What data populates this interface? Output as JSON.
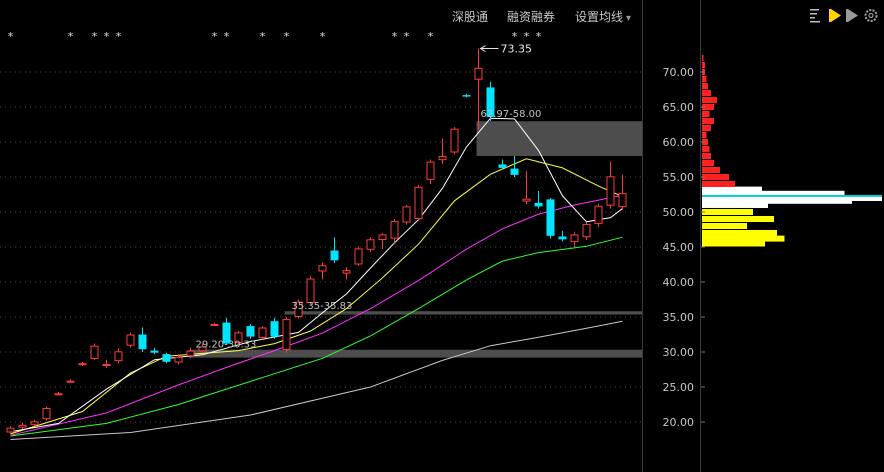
{
  "toolbar": {
    "items": [
      "深股通",
      "融资融券",
      "设置均线"
    ],
    "dropdown_glyph": "▾"
  },
  "right_icons": [
    "bars-icon",
    "play-yellow-icon",
    "play-grey-icon",
    "gear-icon"
  ],
  "colors": {
    "background": "#000000",
    "up": "#ff3a3a",
    "down": "#00e5ff",
    "ma5": "#ffffff",
    "ma10": "#ffff44",
    "ma20": "#ff30ff",
    "ma30": "#30ff30",
    "ma60": "#c8c8c8",
    "axis_text": "#c8c8c8",
    "highlight_box": "#555555"
  },
  "chart_data": {
    "type": "candlestick",
    "price_axis": {
      "min": 15,
      "max": 77,
      "ticks": [
        "20.00",
        "25.00",
        "30.00",
        "35.00",
        "40.00",
        "45.00",
        "50.00",
        "55.00",
        "60.00",
        "65.00",
        "70.00"
      ]
    },
    "candles": [
      [
        18.5,
        19.4,
        18.3,
        19.2
      ],
      [
        19.2,
        19.9,
        19.0,
        19.6
      ],
      [
        19.6,
        20.3,
        19.4,
        20.1
      ],
      [
        20.4,
        22.2,
        20.2,
        22.0
      ],
      [
        24.0,
        24.3,
        23.8,
        24.1
      ],
      [
        25.8,
        26.1,
        25.6,
        25.9
      ],
      [
        28.2,
        28.6,
        28.0,
        28.4
      ],
      [
        29.0,
        31.2,
        28.9,
        30.9
      ],
      [
        28.0,
        28.9,
        27.7,
        28.3
      ],
      [
        28.7,
        30.5,
        28.4,
        30.1
      ],
      [
        30.9,
        32.8,
        30.6,
        32.5
      ],
      [
        32.5,
        33.5,
        30.0,
        30.4
      ],
      [
        30.2,
        30.6,
        29.7,
        29.9
      ],
      [
        29.7,
        29.9,
        28.4,
        28.6
      ],
      [
        28.5,
        29.7,
        28.2,
        29.3
      ],
      [
        29.4,
        30.6,
        29.1,
        30.2
      ],
      [
        30.1,
        31.2,
        29.9,
        30.8
      ],
      [
        33.9,
        34.2,
        33.8,
        34.0
      ],
      [
        34.2,
        34.9,
        31.0,
        31.2
      ],
      [
        31.3,
        33.0,
        31.0,
        32.8
      ],
      [
        33.7,
        34.0,
        31.9,
        32.2
      ],
      [
        32.0,
        33.7,
        31.8,
        33.5
      ],
      [
        34.4,
        34.9,
        31.9,
        32.2
      ],
      [
        30.3,
        35.0,
        29.9,
        34.7
      ],
      [
        35.0,
        37.5,
        34.8,
        37.2
      ],
      [
        37.0,
        40.8,
        36.8,
        40.5
      ],
      [
        41.5,
        42.8,
        40.4,
        42.4
      ],
      [
        44.5,
        46.4,
        42.7,
        43.1
      ],
      [
        41.2,
        42.1,
        40.4,
        41.7
      ],
      [
        42.5,
        45.1,
        42.3,
        44.8
      ],
      [
        44.6,
        46.4,
        44.3,
        46.1
      ],
      [
        46.0,
        47.0,
        44.7,
        46.8
      ],
      [
        46.2,
        49.0,
        45.6,
        48.7
      ],
      [
        48.5,
        51.0,
        48.2,
        50.8
      ],
      [
        49.0,
        53.9,
        48.7,
        53.6
      ],
      [
        54.6,
        57.5,
        54.0,
        57.2
      ],
      [
        57.4,
        60.5,
        56.9,
        58.0
      ],
      [
        58.5,
        62.1,
        58.2,
        61.9
      ],
      [
        66.7,
        66.9,
        66.4,
        66.6
      ],
      [
        68.9,
        73.35,
        61.8,
        70.6
      ],
      [
        67.8,
        68.6,
        63.0,
        63.6
      ],
      [
        56.8,
        57.5,
        56.1,
        56.3
      ],
      [
        56.2,
        58.0,
        55.0,
        55.3
      ],
      [
        51.5,
        55.8,
        51.1,
        51.9
      ],
      [
        51.3,
        53.0,
        50.5,
        50.8
      ],
      [
        51.8,
        52.0,
        46.2,
        46.6
      ],
      [
        46.5,
        47.3,
        45.8,
        46.1
      ],
      [
        45.7,
        47.1,
        45.0,
        46.8
      ],
      [
        46.4,
        48.5,
        46.0,
        48.3
      ],
      [
        48.3,
        51.2,
        47.8,
        50.9
      ],
      [
        50.9,
        57.2,
        50.5,
        55.1
      ],
      [
        50.7,
        55.3,
        50.3,
        52.7
      ]
    ],
    "ma5": [
      [
        0,
        18.6
      ],
      [
        4,
        19.8
      ],
      [
        8,
        24.7
      ],
      [
        12,
        28.9
      ],
      [
        16,
        29.6
      ],
      [
        20,
        31.5
      ],
      [
        24,
        32.8
      ],
      [
        26,
        35.6
      ],
      [
        28,
        38.3
      ],
      [
        30,
        42.0
      ],
      [
        32,
        45.6
      ],
      [
        34,
        48.9
      ],
      [
        36,
        53.4
      ],
      [
        38,
        59.3
      ],
      [
        40,
        63.4
      ],
      [
        42,
        63.3
      ],
      [
        44,
        58.8
      ],
      [
        46,
        52.3
      ],
      [
        48,
        48.6
      ],
      [
        50,
        49.2
      ],
      [
        51,
        50.5
      ]
    ],
    "ma10": [
      [
        0,
        18.3
      ],
      [
        6,
        21.5
      ],
      [
        10,
        27.0
      ],
      [
        13,
        29.4
      ],
      [
        16,
        29.8
      ],
      [
        19,
        30.2
      ],
      [
        22,
        31.2
      ],
      [
        25,
        33.0
      ],
      [
        28,
        36.2
      ],
      [
        31,
        40.6
      ],
      [
        34,
        45.4
      ],
      [
        37,
        51.6
      ],
      [
        40,
        55.4
      ],
      [
        43,
        57.6
      ],
      [
        46,
        56.3
      ],
      [
        49,
        53.7
      ],
      [
        51,
        52.2
      ]
    ],
    "ma20": [
      [
        0,
        18.1
      ],
      [
        8,
        21.3
      ],
      [
        14,
        25.3
      ],
      [
        18,
        27.8
      ],
      [
        22,
        30.2
      ],
      [
        26,
        32.7
      ],
      [
        30,
        36.2
      ],
      [
        34,
        40.2
      ],
      [
        38,
        44.7
      ],
      [
        41,
        47.6
      ],
      [
        44,
        49.7
      ],
      [
        47,
        51.0
      ],
      [
        51,
        52.4
      ]
    ],
    "ma30": [
      [
        0,
        18.0
      ],
      [
        8,
        19.8
      ],
      [
        14,
        22.5
      ],
      [
        20,
        25.8
      ],
      [
        26,
        29.1
      ],
      [
        30,
        32.3
      ],
      [
        34,
        36.2
      ],
      [
        38,
        40.3
      ],
      [
        41,
        43.0
      ],
      [
        44,
        44.2
      ],
      [
        48,
        45.1
      ],
      [
        51,
        46.4
      ]
    ],
    "ma60": [
      [
        0,
        17.5
      ],
      [
        10,
        18.5
      ],
      [
        20,
        21.0
      ],
      [
        30,
        25.0
      ],
      [
        36,
        28.8
      ],
      [
        40,
        30.9
      ],
      [
        44,
        32.1
      ],
      [
        48,
        33.4
      ],
      [
        51,
        34.4
      ]
    ],
    "annotations": {
      "high_label": "73.35",
      "range_labels": [
        "62.97-58.00",
        "35.35-35.83",
        "29.20-30.33"
      ]
    },
    "zones": [
      {
        "from": 58.0,
        "to": 62.97,
        "from_candle": 39
      },
      {
        "from": 35.35,
        "to": 35.83,
        "from_candle": 23
      },
      {
        "from": 29.2,
        "to": 30.33,
        "from_candle": 15
      }
    ],
    "event_marker_candles": [
      0,
      5,
      7,
      8,
      9,
      17,
      18,
      21,
      23,
      26,
      32,
      33,
      35,
      42,
      43,
      44
    ],
    "volume_profile": {
      "levels": [
        45.5,
        46.2,
        47.0,
        48.0,
        49.0,
        50.0,
        51.0,
        51.6,
        52.0,
        52.6,
        53.2,
        54.0,
        55.0,
        56.0,
        57.0,
        58.0,
        59.0,
        60.0,
        61.0,
        62.0,
        63.0,
        64.0,
        65.0,
        66.0,
        67.0,
        68.0,
        69.0,
        70.0,
        71.0,
        72.0
      ],
      "volumes": [
        42,
        55,
        50,
        30,
        48,
        34,
        44,
        100,
        120,
        95,
        40,
        22,
        18,
        12,
        8,
        6,
        5,
        4,
        3,
        6,
        8,
        5,
        8,
        10,
        6,
        4,
        3,
        2,
        2,
        1
      ]
    }
  }
}
